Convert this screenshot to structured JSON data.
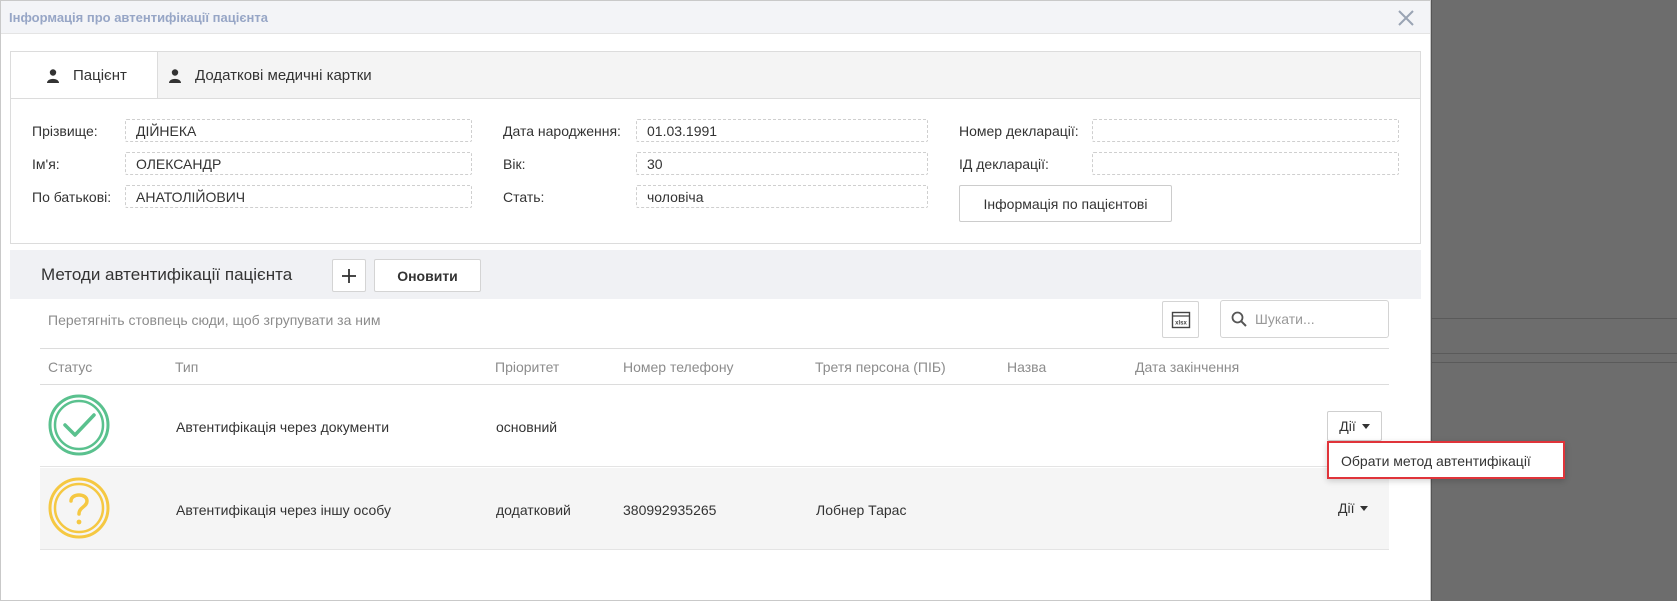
{
  "window": {
    "title": "Інформація про автентифікації пацієнта"
  },
  "tabs": [
    {
      "label": "Пацієнт",
      "active": true
    },
    {
      "label": "Додаткові медичні картки",
      "active": false
    }
  ],
  "patient": {
    "surname_label": "Прізвище:",
    "surname": "ДІЙНЕКА",
    "name_label": "Ім'я:",
    "name": "ОЛЕКСАНДР",
    "patronymic_label": "По батькові:",
    "patronymic": "АНАТОЛІЙОВИЧ",
    "birthdate_label": "Дата народження:",
    "birthdate": "01.03.1991",
    "age_label": "Вік:",
    "age": "30",
    "sex_label": "Стать:",
    "sex": "чоловіча",
    "declaration_number_label": "Номер декларації:",
    "declaration_number": "",
    "declaration_id_label": "ІД декларації:",
    "declaration_id": "",
    "info_button": "Інформація по пацієнтові"
  },
  "auth_section": {
    "title": "Методи автентифікації пацієнта",
    "refresh_label": "Оновити",
    "group_hint": "Перетягніть стовпець сюди, щоб згрупувати за ним",
    "export_label": "xlsx",
    "search_placeholder": "Шукати..."
  },
  "grid": {
    "columns": [
      "Статус",
      "Тип",
      "Пріоритет",
      "Номер телефону",
      "Третя персона (ПІБ)",
      "Назва",
      "Дата закінчення"
    ],
    "rows": [
      {
        "status": "verified",
        "type": "Автентифікація через документи",
        "priority": "основний",
        "phone": "",
        "third_person": "",
        "name": "",
        "end_date": "",
        "actions": "Дії"
      },
      {
        "status": "pending",
        "type": "Автентифікація через іншу особу",
        "priority": "додатковий",
        "phone": "380992935265",
        "third_person": "Лобнер Тарас",
        "name": "",
        "end_date": "",
        "actions": "Дії"
      }
    ]
  },
  "dropdown": {
    "item": "Обрати метод автентифікації"
  },
  "colors": {
    "status_ok": "#5ac18e",
    "status_pending": "#f5c842",
    "highlight": "#e0343a",
    "title_text": "#97a6c6"
  }
}
